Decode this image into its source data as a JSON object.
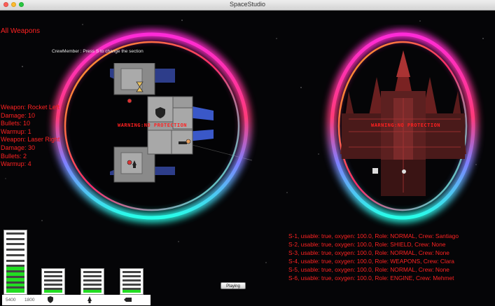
{
  "window": {
    "title": "SpaceStudio"
  },
  "labels": {
    "all_weapons": "All Weapons",
    "hint": "CrewMember : Press S to change the section",
    "section_tag": "WARNING:NO PROTECTION"
  },
  "weapons": [
    "Weapon: Rocket Left",
    " Damage: 10",
    " Bullets: 10",
    " Warmup: 1",
    "Weapon: Laser Right",
    " Damage: 30",
    " Bullets: 2",
    " Warmup: 4"
  ],
  "sections": [
    "S-1, usable: true, oxygen: 100.0, Role: NORMAL, Crew: Santiago",
    "S-2, usable: true, oxygen: 100.0, Role: SHIELD, Crew: None",
    "S-3, usable: true, oxygen: 100.0, Role: NORMAL, Crew: None",
    "S-4, usable: true, oxygen: 100.0, Role: WEAPONS, Crew: Clara",
    "S-5, usable: true, oxygen: 100.0, Role: NORMAL, Crew: None",
    "S-6, usable: true, oxygen: 100.0, Role: ENGINE, Crew: Mehmet"
  ],
  "hud": {
    "value_left": "5400",
    "value_right": "1800",
    "gauges": [
      {
        "name": "energy",
        "bars": 11,
        "level": 0.45
      },
      {
        "name": "shield",
        "bars": 5,
        "level": 0.15
      },
      {
        "name": "crew",
        "bars": 5,
        "level": 0.15
      },
      {
        "name": "weapon",
        "bars": 5,
        "level": 0.15
      }
    ],
    "icons": [
      "shield-icon",
      "crew-icon",
      "weapon-icon"
    ]
  },
  "button": {
    "playing": "Playing"
  },
  "colors": {
    "text_red": "#ff2222",
    "ring_magenta": "#ff2bd8",
    "ring_cyan": "#27ffe8",
    "ring_orange": "#ffb020",
    "gauge_green": "#22dd22"
  }
}
